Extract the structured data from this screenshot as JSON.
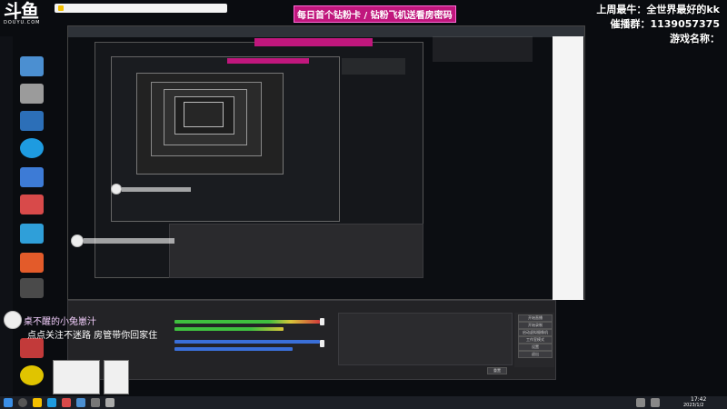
{
  "overlay": {
    "logo_main": "斗鱼",
    "logo_sub": "DOUYU.COM",
    "top_banner": "每日首个钻粉卡 / 钻粉飞机送看房密码",
    "weekly_top_label": "上周最牛：全世界最好的kk",
    "fan_group_label": "催播群：1139057375",
    "game_name_label": "游戏名称："
  },
  "chat": {
    "username": "桌不醒的小兔崽汁",
    "message": "点点关注不迷路 房管带你回家住"
  },
  "taskbar": {
    "clock_time": "17:42",
    "clock_date": "2023/1/2"
  },
  "obs": {
    "buttons": [
      "开始直播",
      "开始录制",
      "启动虚拟摄像机",
      "工作室模式",
      "设置",
      "退出"
    ],
    "bottom_button": "重置"
  },
  "colors": {
    "banner": "#c0177d",
    "chat_user": "#f5d0ff",
    "meter_green": "#3fbf3f",
    "meter_yellow": "#d8c53a",
    "meter_red": "#d13a3a"
  },
  "icons": [
    "windows-start-icon",
    "search-icon",
    "wifi-icon",
    "volume-icon",
    "folder-icon",
    "browser-icon"
  ]
}
